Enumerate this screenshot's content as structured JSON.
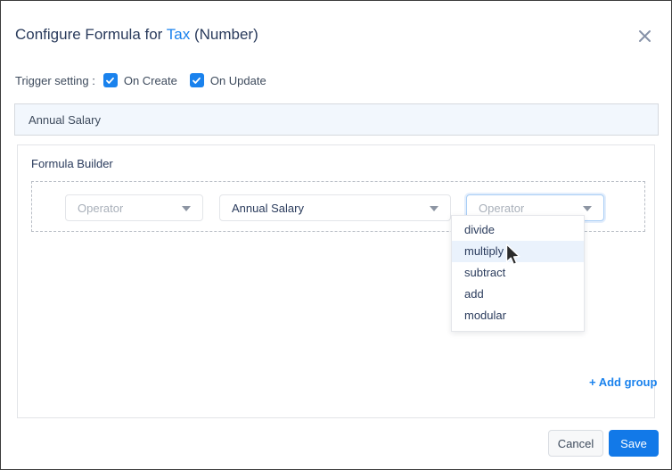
{
  "dialog": {
    "title_prefix": "Configure Formula for ",
    "title_field": "Tax",
    "title_suffix": " (Number)",
    "close_icon": "close-icon"
  },
  "trigger": {
    "label": "Trigger setting :",
    "options": [
      {
        "label": "On Create",
        "checked": true
      },
      {
        "label": "On Update",
        "checked": true
      }
    ]
  },
  "source_field": {
    "label": "Annual Salary"
  },
  "builder": {
    "title": "Formula Builder",
    "add_group_label": "+ Add group",
    "selects": [
      {
        "name": "operator-1",
        "value": "Operator",
        "is_placeholder": true,
        "icon": "chevron-down-icon"
      },
      {
        "name": "field-1",
        "value": "Annual Salary",
        "is_placeholder": false,
        "icon": "chevron-down-icon"
      },
      {
        "name": "operator-2",
        "value": "Operator",
        "is_placeholder": true,
        "icon": "chevron-down-icon"
      }
    ],
    "operator_menu": {
      "items": [
        "divide",
        "multiply",
        "subtract",
        "add",
        "modular"
      ],
      "highlighted": "multiply"
    }
  },
  "footer": {
    "cancel_label": "Cancel",
    "save_label": "Save"
  },
  "colors": {
    "accent": "#1a82ed",
    "save_button": "#1279e8",
    "text_dark": "#2a3b5c",
    "placeholder": "#a9b0ba",
    "banner_bg": "#f2f7fd",
    "menu_highlight": "#eaf2fc"
  }
}
